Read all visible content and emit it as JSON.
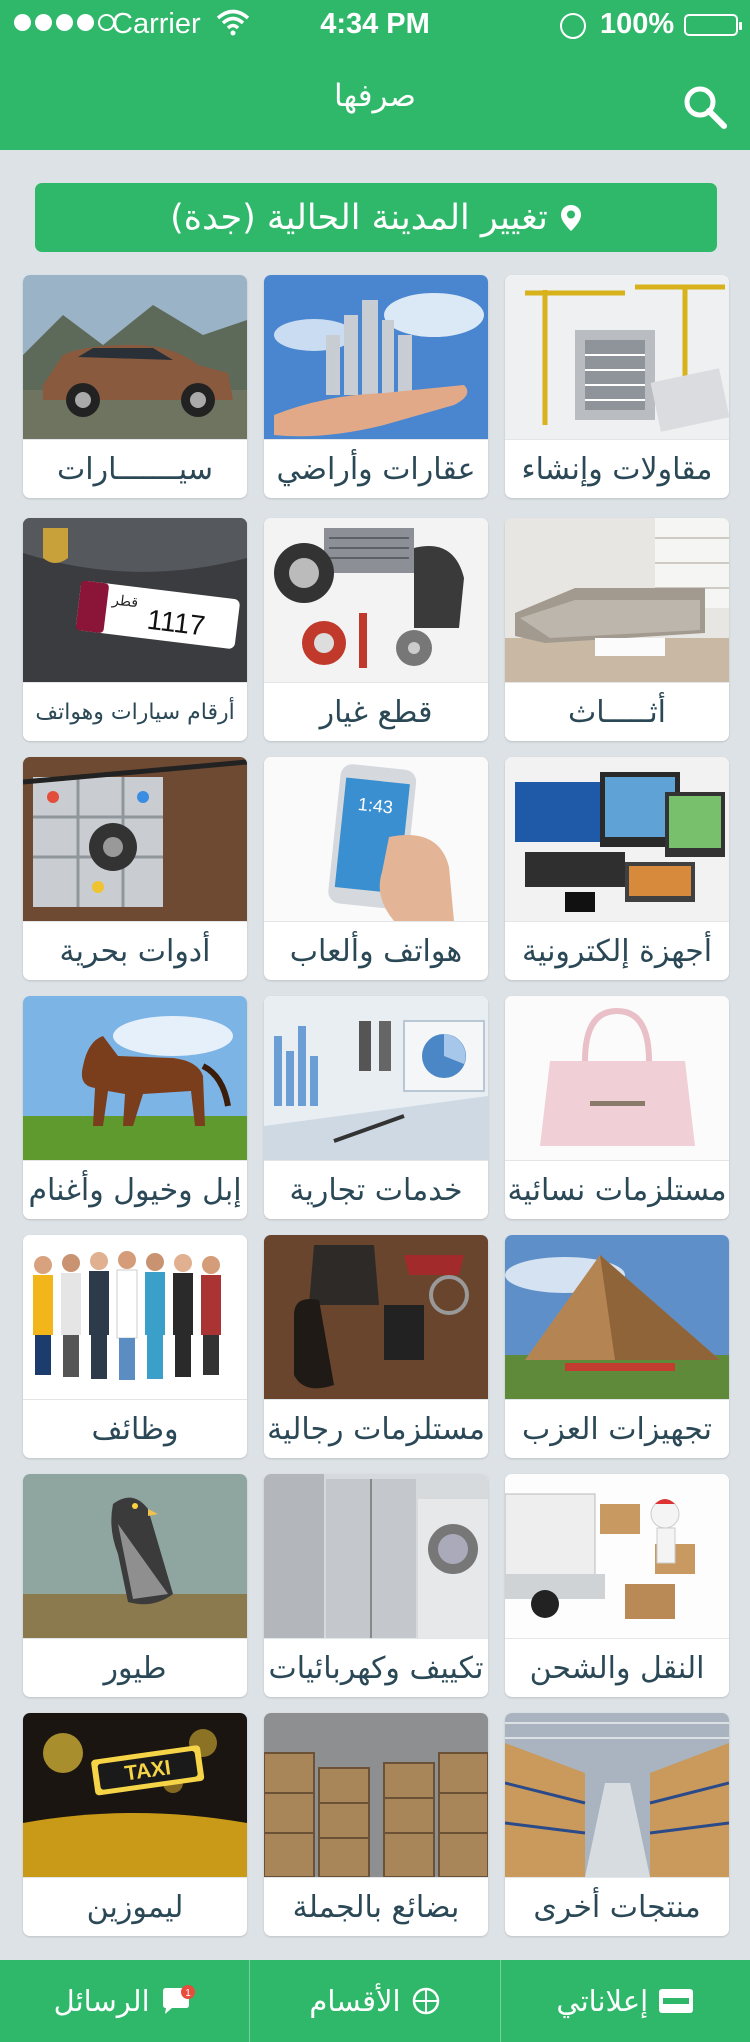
{
  "status_bar": {
    "carrier": "Carrier",
    "time": "4:34 PM",
    "battery": "100%"
  },
  "header": {
    "title": "صرفها",
    "search_icon": "search-icon"
  },
  "city_button": {
    "label": "تغيير المدينة الحالية (جدة)",
    "icon": "location-pin-icon"
  },
  "categories": [
    {
      "label": "مقاولات وإنشاء"
    },
    {
      "label": "عقارات وأراضي"
    },
    {
      "label": "سيـــــــارات"
    },
    {
      "label": "أثـــــاث"
    },
    {
      "label": "قطع غيار"
    },
    {
      "label": "أرقام سيارات وهواتف"
    },
    {
      "label": "أجهزة إلكترونية"
    },
    {
      "label": "هواتف وألعاب"
    },
    {
      "label": "أدوات بحرية"
    },
    {
      "label": "مستلزمات نسائية"
    },
    {
      "label": "خدمات تجارية"
    },
    {
      "label": "إبل وخيول وأغنام"
    },
    {
      "label": "تجهيزات العزب"
    },
    {
      "label": "مستلزمات رجالية"
    },
    {
      "label": "وظائف"
    },
    {
      "label": "النقل والشحن"
    },
    {
      "label": "تكييف وكهربائيات"
    },
    {
      "label": "طيور"
    },
    {
      "label": "منتجات أخرى"
    },
    {
      "label": "بضائع بالجملة"
    },
    {
      "label": "ليموزين"
    }
  ],
  "plate": {
    "number": "1117",
    "country": "قطر"
  },
  "phone_screen_time": "1:43",
  "taxi_sign": "TAXI",
  "tab_bar": {
    "my_ads": "إعلاناتي",
    "my_ads_badge_icon": "sale-tag-icon",
    "sections": "الأقسام",
    "messages": "الرسائل",
    "messages_badge": "1"
  },
  "colors": {
    "brand_green": "#2fb86a",
    "background": "#dde2e6",
    "label_text": "#2b4856"
  }
}
